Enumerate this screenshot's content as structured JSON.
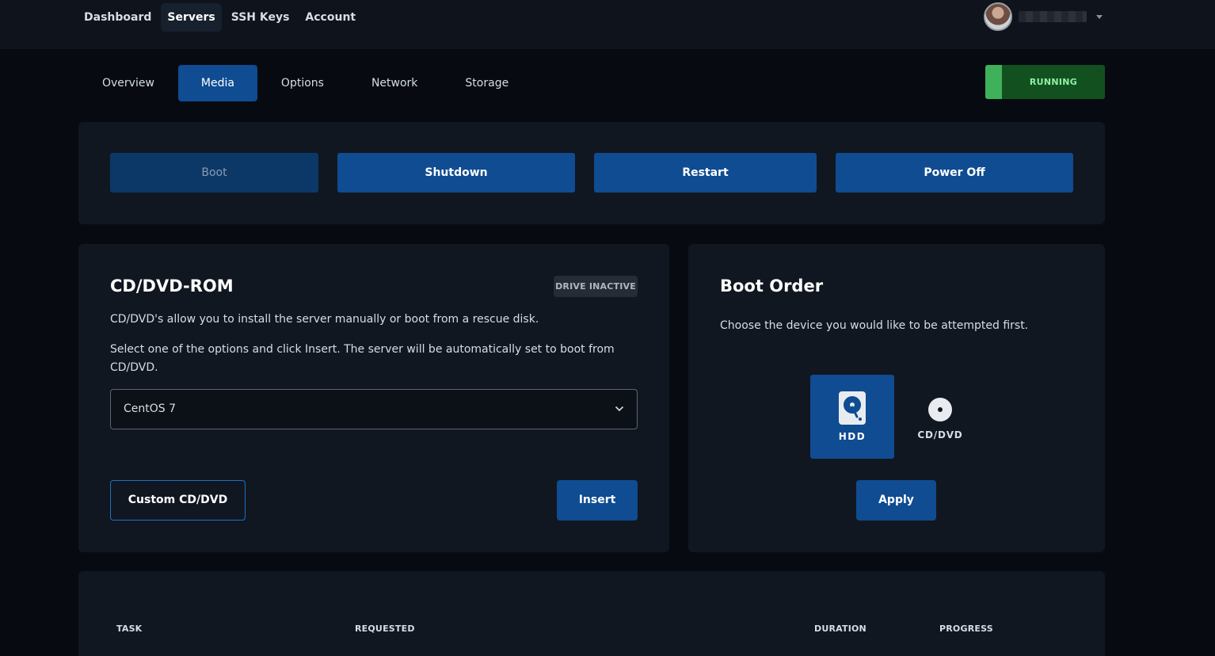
{
  "topnav": {
    "items": [
      {
        "label": "Dashboard",
        "active": false
      },
      {
        "label": "Servers",
        "active": true
      },
      {
        "label": "SSH Keys",
        "active": false
      },
      {
        "label": "Account",
        "active": false
      }
    ]
  },
  "subtabs": {
    "items": [
      {
        "label": "Overview",
        "active": false
      },
      {
        "label": "Media",
        "active": true
      },
      {
        "label": "Options",
        "active": false
      },
      {
        "label": "Network",
        "active": false
      },
      {
        "label": "Storage",
        "active": false
      }
    ]
  },
  "status": {
    "label": "RUNNING",
    "color": "#3fb15a"
  },
  "power": {
    "boot_label": "Boot",
    "shutdown_label": "Shutdown",
    "restart_label": "Restart",
    "poweroff_label": "Power Off"
  },
  "cdrom": {
    "title": "CD/DVD-ROM",
    "badge": "DRIVE INACTIVE",
    "description": "CD/DVD's allow you to install the server manually or boot from a rescue disk.",
    "instructions": "Select one of the options and click Insert. The server will be automatically set to boot from CD/DVD.",
    "selected_image": "CentOS 7",
    "custom_label": "Custom CD/DVD",
    "insert_label": "Insert"
  },
  "boot_order": {
    "title": "Boot Order",
    "description": "Choose the device you would like to be attempted first.",
    "devices": [
      {
        "label": "HDD",
        "icon": "hdd-icon",
        "selected": true
      },
      {
        "label": "CD/DVD",
        "icon": "disc-icon",
        "selected": false
      }
    ],
    "apply_label": "Apply"
  },
  "tasks": {
    "columns": [
      "TASK",
      "REQUESTED",
      "DURATION",
      "PROGRESS"
    ]
  },
  "colors": {
    "accent": "#0f4c92",
    "background": "#070b11",
    "card": "#111720"
  }
}
